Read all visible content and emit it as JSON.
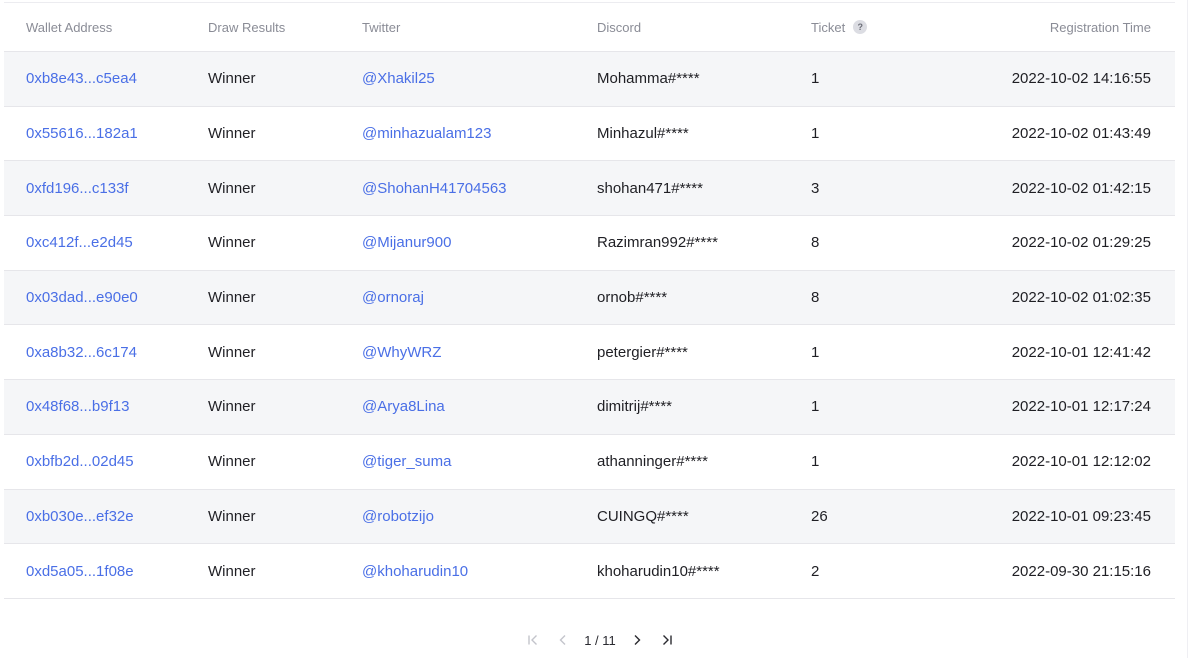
{
  "table": {
    "headers": {
      "wallet": "Wallet Address",
      "draw": "Draw Results",
      "twitter": "Twitter",
      "discord": "Discord",
      "ticket": "Ticket",
      "time": "Registration Time"
    },
    "ticket_help_icon": "?",
    "rows": [
      {
        "wallet": "0xb8e43...c5ea4",
        "draw": "Winner",
        "twitter": "@Xhakil25",
        "discord": "Mohamma#****",
        "ticket": "1",
        "time": "2022-10-02 14:16:55"
      },
      {
        "wallet": "0x55616...182a1",
        "draw": "Winner",
        "twitter": "@minhazualam123",
        "discord": "Minhazul#****",
        "ticket": "1",
        "time": "2022-10-02 01:43:49"
      },
      {
        "wallet": "0xfd196...c133f",
        "draw": "Winner",
        "twitter": "@ShohanH41704563",
        "discord": "shohan471#****",
        "ticket": "3",
        "time": "2022-10-02 01:42:15"
      },
      {
        "wallet": "0xc412f...e2d45",
        "draw": "Winner",
        "twitter": "@Mijanur900",
        "discord": "Razimran992#****",
        "ticket": "8",
        "time": "2022-10-02 01:29:25"
      },
      {
        "wallet": "0x03dad...e90e0",
        "draw": "Winner",
        "twitter": "@ornoraj",
        "discord": "ornob#****",
        "ticket": "8",
        "time": "2022-10-02 01:02:35"
      },
      {
        "wallet": "0xa8b32...6c174",
        "draw": "Winner",
        "twitter": "@WhyWRZ",
        "discord": "petergier#****",
        "ticket": "1",
        "time": "2022-10-01 12:41:42"
      },
      {
        "wallet": "0x48f68...b9f13",
        "draw": "Winner",
        "twitter": "@Arya8Lina",
        "discord": "dimitrij#****",
        "ticket": "1",
        "time": "2022-10-01 12:17:24"
      },
      {
        "wallet": "0xbfb2d...02d45",
        "draw": "Winner",
        "twitter": "@tiger_suma",
        "discord": "athanninger#****",
        "ticket": "1",
        "time": "2022-10-01 12:12:02"
      },
      {
        "wallet": "0xb030e...ef32e",
        "draw": "Winner",
        "twitter": "@robotzijo",
        "discord": "CUINGQ#****",
        "ticket": "26",
        "time": "2022-10-01 09:23:45"
      },
      {
        "wallet": "0xd5a05...1f08e",
        "draw": "Winner",
        "twitter": "@khoharudin10",
        "discord": "khoharudin10#****",
        "ticket": "2",
        "time": "2022-09-30 21:15:16"
      }
    ]
  },
  "pagination": {
    "page_text": "1 / 11"
  },
  "colors": {
    "link": "#4a6fe6",
    "stripe": "#f5f6f8",
    "header_text": "#8a8c96"
  }
}
